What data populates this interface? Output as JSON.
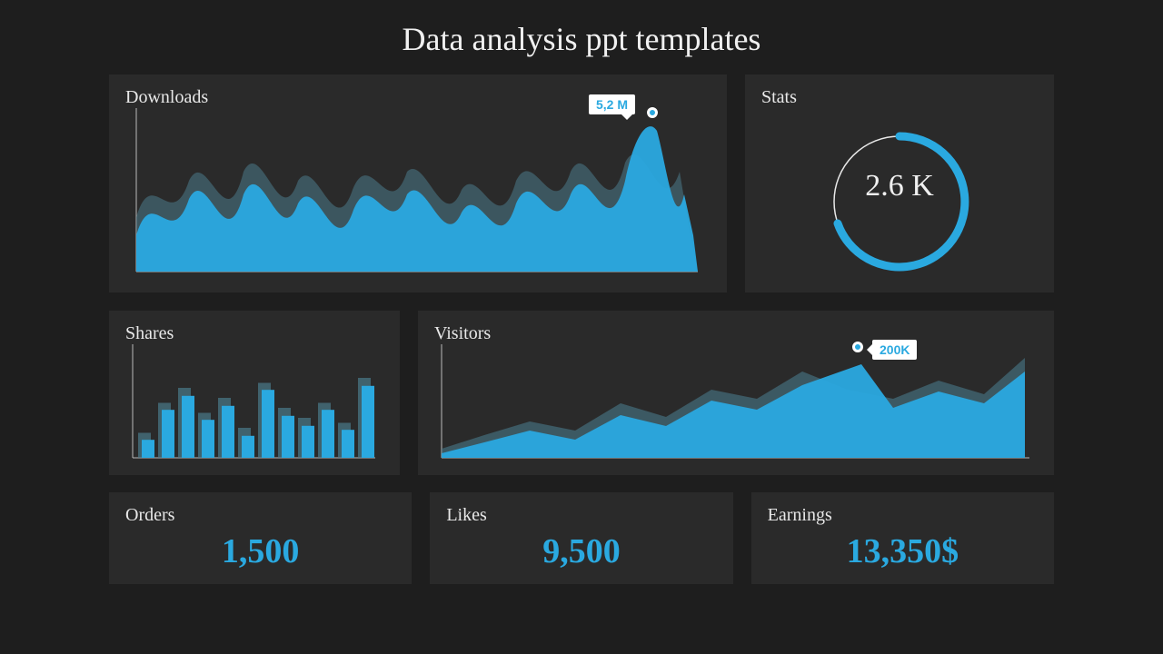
{
  "title": "Data analysis ppt templates",
  "cards": {
    "downloads": {
      "title": "Downloads",
      "peak_label": "5,2 M"
    },
    "stats": {
      "title": "Stats",
      "value": "2.6 K"
    },
    "shares": {
      "title": "Shares"
    },
    "visitors": {
      "title": "Visitors",
      "peak_label": "200K"
    },
    "orders": {
      "title": "Orders",
      "value": "1,500"
    },
    "likes": {
      "title": "Likes",
      "value": "9,500"
    },
    "earnings": {
      "title": "Earnings",
      "value": "13,350$"
    }
  },
  "chart_data": [
    {
      "id": "downloads",
      "type": "area",
      "title": "Downloads",
      "peak_label": "5,2 M",
      "series": [
        {
          "name": "back",
          "values": [
            30,
            55,
            40,
            70,
            35,
            80,
            50,
            75,
            45,
            90,
            60,
            85,
            55,
            70,
            40,
            65,
            50,
            80,
            60,
            95,
            75,
            60,
            88,
            50
          ]
        },
        {
          "name": "front",
          "values": [
            20,
            60,
            35,
            75,
            30,
            70,
            45,
            80,
            40,
            85,
            55,
            78,
            48,
            62,
            35,
            58,
            45,
            72,
            55,
            98,
            68,
            55,
            80,
            45
          ]
        }
      ]
    },
    {
      "id": "stats",
      "type": "pie",
      "title": "Stats",
      "center_value": "2.6 K",
      "progress_pct": 62
    },
    {
      "id": "shares",
      "type": "bar",
      "title": "Shares",
      "series": [
        {
          "name": "back",
          "values": [
            25,
            55,
            70,
            45,
            60,
            30,
            75,
            50,
            40,
            55,
            35,
            80
          ]
        },
        {
          "name": "front",
          "values": [
            18,
            48,
            62,
            38,
            52,
            22,
            68,
            42,
            32,
            48,
            28,
            72
          ]
        }
      ]
    },
    {
      "id": "visitors",
      "type": "area",
      "title": "Visitors",
      "peak_label": "200K",
      "series": [
        {
          "name": "back",
          "values": [
            10,
            20,
            35,
            25,
            50,
            40,
            65,
            55,
            90,
            70,
            60,
            80,
            65,
            95
          ]
        },
        {
          "name": "front",
          "values": [
            5,
            15,
            28,
            20,
            42,
            32,
            58,
            48,
            100,
            62,
            52,
            72,
            58,
            85
          ]
        }
      ]
    }
  ],
  "colors": {
    "accent": "#2aa9e0",
    "accent_dim": "#4a7a8a",
    "card_bg": "#2a2a2a",
    "page_bg": "#1e1e1e"
  }
}
